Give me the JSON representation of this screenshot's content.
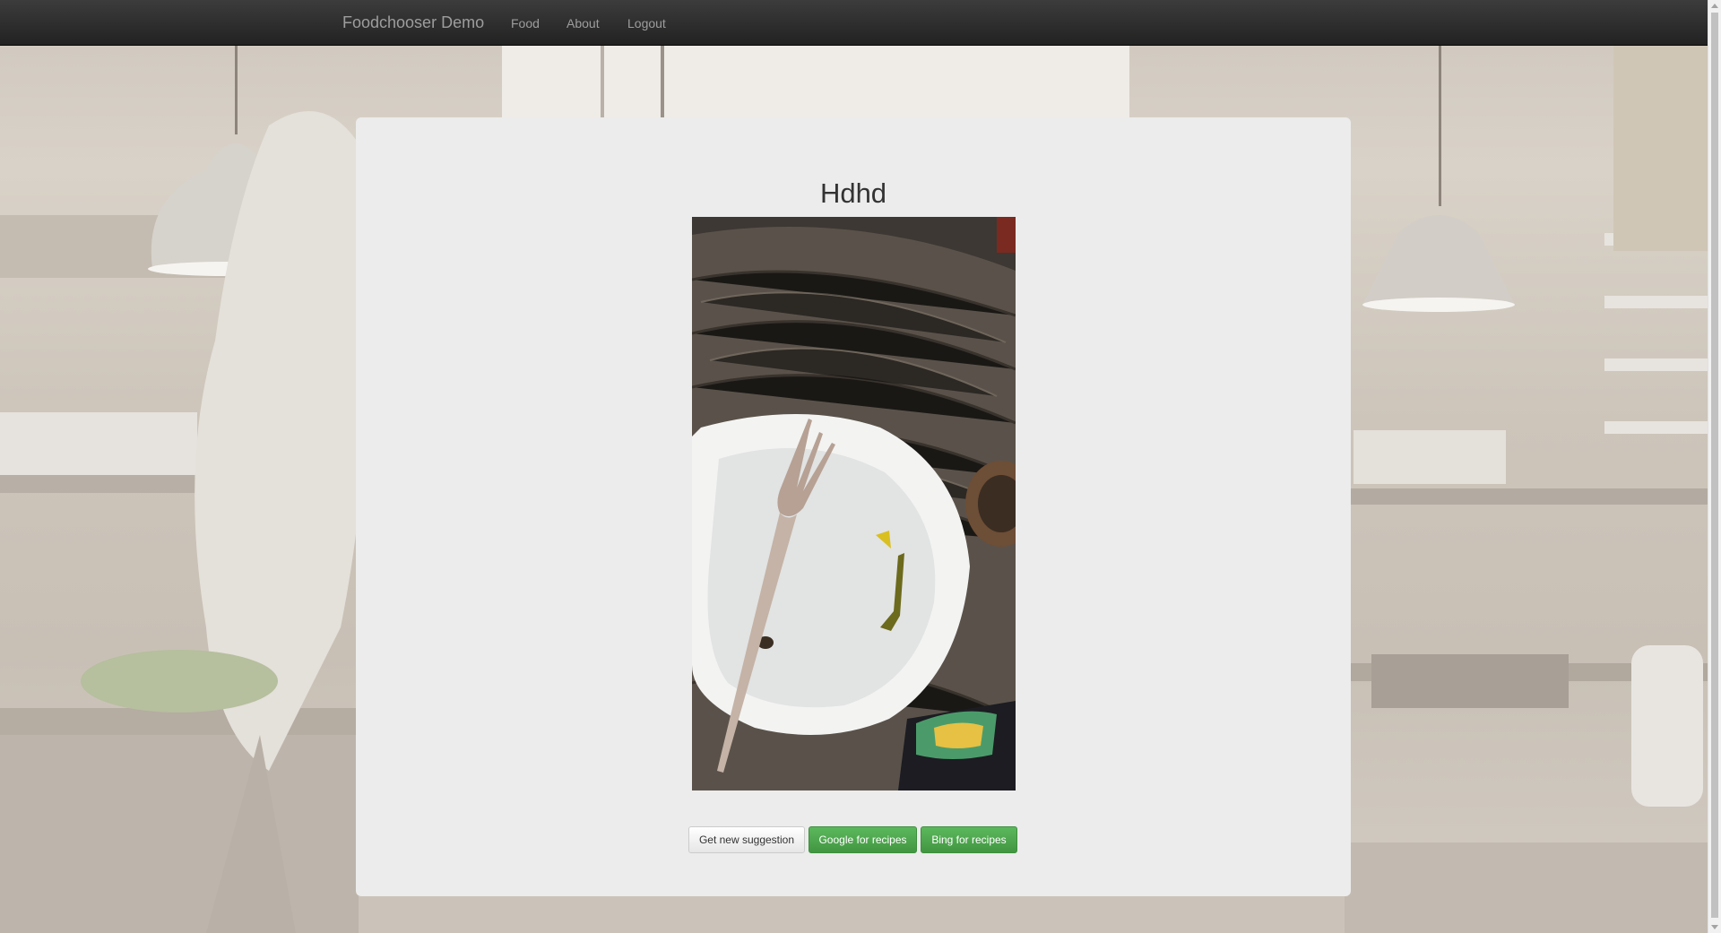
{
  "navbar": {
    "brand": "Foodchooser Demo",
    "links": [
      "Food",
      "About",
      "Logout"
    ]
  },
  "food": {
    "title": "Hdhd",
    "image_icon": "food-photo-plate-fork-icon"
  },
  "actions": {
    "new_suggestion": "Get new suggestion",
    "google": "Google for recipes",
    "bing": "Bing for recipes"
  },
  "colors": {
    "navbar_bg": "#222222",
    "panel_bg": "#ececec",
    "success": "#5cb85c"
  }
}
